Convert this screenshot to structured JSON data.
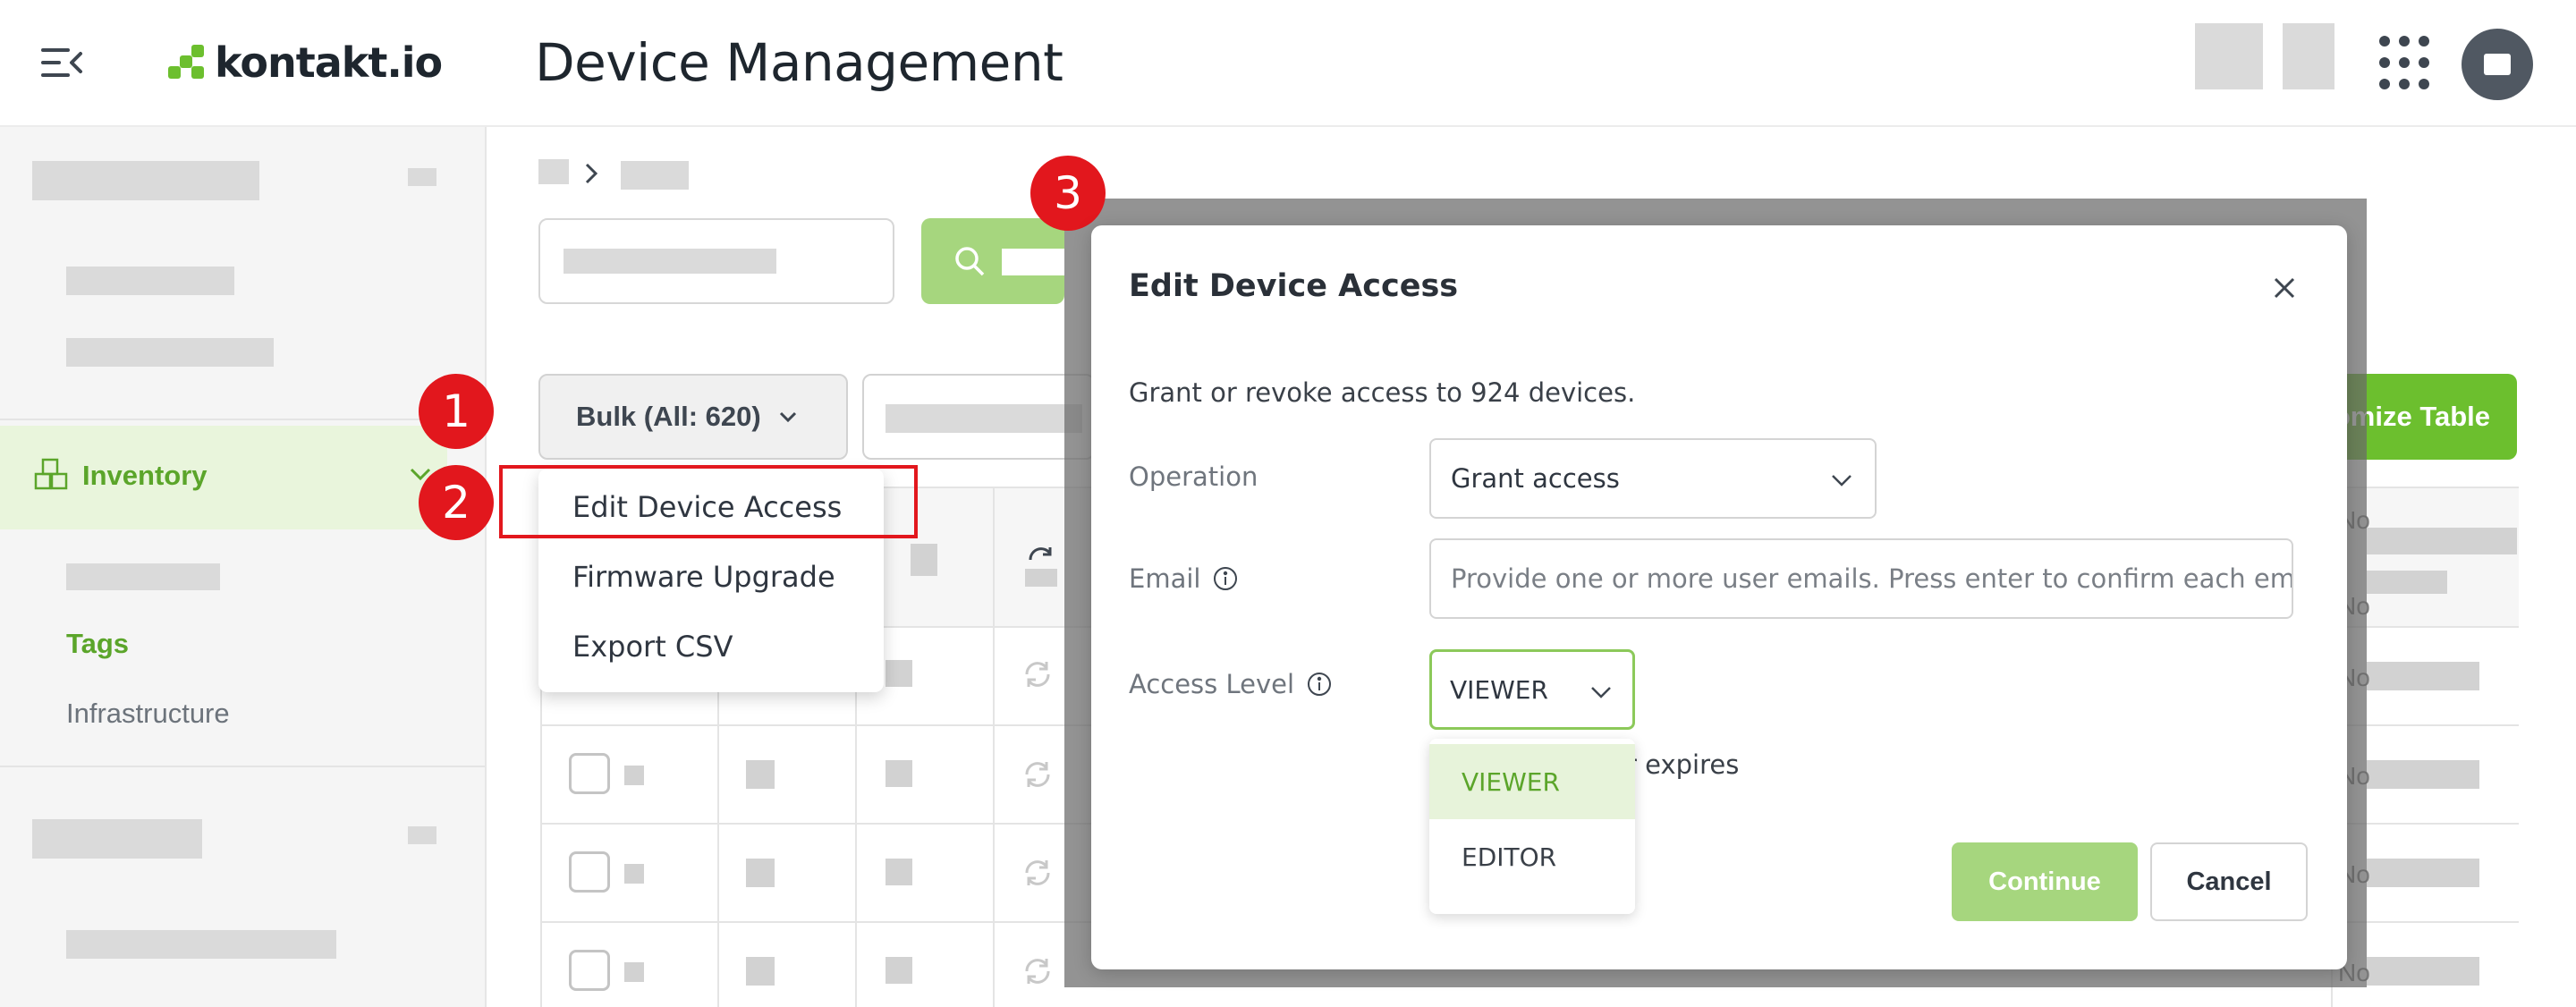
{
  "header": {
    "logo_text": "kontakt.io",
    "title": "Device Management"
  },
  "sidebar": {
    "active_item": "Inventory",
    "sub_items": [
      "Tags",
      "Infrastructure"
    ]
  },
  "toolbar": {
    "bulk_label": "Bulk (All: 620)",
    "customize_label": "Customize Table"
  },
  "bulk_menu": {
    "items": [
      "Edit Device Access",
      "Firmware Upgrade",
      "Export CSV"
    ]
  },
  "steps": [
    "1",
    "2",
    "3"
  ],
  "table": {
    "right_col_text": "No"
  },
  "modal": {
    "title": "Edit Device Access",
    "description": "Grant or revoke access to 924 devices.",
    "operation_label": "Operation",
    "operation_value": "Grant access",
    "email_label": "Email",
    "email_placeholder": "Provide one or more user emails. Press enter to confirm each email",
    "access_level_label": "Access Level",
    "access_level_value": "VIEWER",
    "access_level_options": [
      "VIEWER",
      "EDITOR"
    ],
    "expires_text": "r expires",
    "continue_label": "Continue",
    "cancel_label": "Cancel"
  },
  "colors": {
    "brand_green": "#6cbf2e",
    "light_green": "#a6d67e",
    "highlight_red": "#e2171d"
  }
}
